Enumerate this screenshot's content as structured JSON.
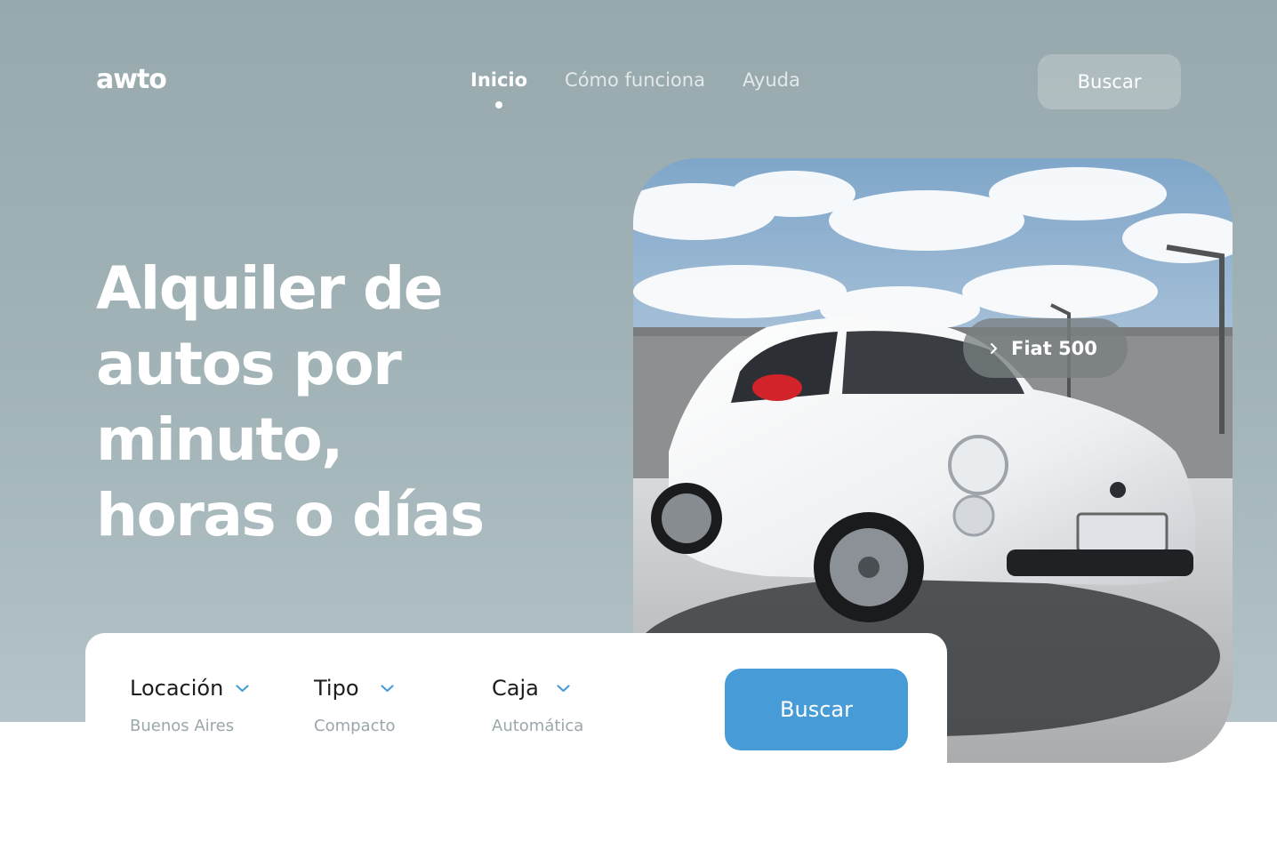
{
  "brand": {
    "logo_text": "awto"
  },
  "nav": {
    "items": [
      {
        "label": "Inicio",
        "active": true
      },
      {
        "label": "Cómo funciona",
        "active": false
      },
      {
        "label": "Ayuda",
        "active": false
      }
    ],
    "search_label": "Buscar"
  },
  "hero": {
    "title_lines": [
      "Alquiler de",
      "autos por",
      "minuto,",
      "horas o días"
    ]
  },
  "featured_car": {
    "model": "Fiat 500",
    "icon": "chevron-right-icon"
  },
  "search": {
    "fields": [
      {
        "label": "Locación",
        "value": "Buenos Aires",
        "icon": "chevron-down-icon"
      },
      {
        "label": "Tipo",
        "value": "Compacto",
        "icon": "chevron-down-icon"
      },
      {
        "label": "Caja",
        "value": "Automática",
        "icon": "chevron-down-icon"
      }
    ],
    "button_label": "Buscar"
  },
  "colors": {
    "hero_background": "#a3b4b8",
    "accent": "#479cd8",
    "field_value": "#9aa7ab"
  }
}
